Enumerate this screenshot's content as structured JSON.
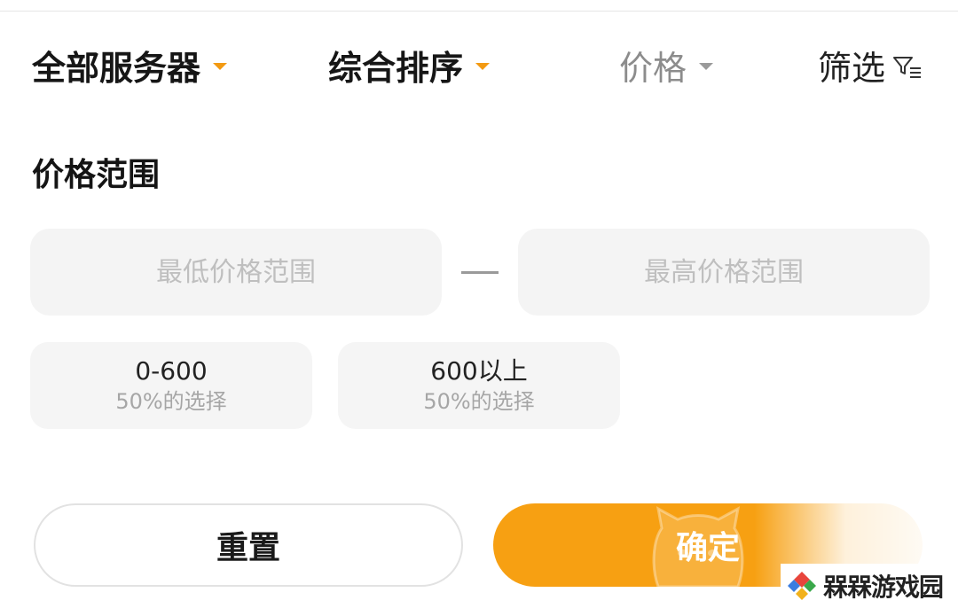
{
  "tabs": [
    {
      "label": "全部服务器"
    },
    {
      "label": "综合排序"
    },
    {
      "label": "价格"
    },
    {
      "label": "筛选"
    }
  ],
  "section": {
    "title": "价格范围"
  },
  "price_range": {
    "min_placeholder": "最低价格范围",
    "min_value": "",
    "max_placeholder": "最高价格范围",
    "max_value": ""
  },
  "presets": [
    {
      "label": "0-600",
      "sub": "50%的选择"
    },
    {
      "label": "600以上",
      "sub": "50%的选择"
    }
  ],
  "buttons": {
    "reset_label": "重置",
    "confirm_label": "确定"
  },
  "watermark": {
    "text": "槑槑游戏园"
  },
  "colors": {
    "accent": "#f7a012",
    "caret_active": "#f39a12",
    "caret_inactive": "#9a9a9a",
    "chip_bg": "#f5f5f5",
    "input_bg": "#f4f4f4"
  },
  "icons": {
    "dropdown": "caret-down-icon",
    "filter": "filter-funnel-icon",
    "brand": "cat-face-icon",
    "watermark_logo": "diamond-logo-icon"
  }
}
